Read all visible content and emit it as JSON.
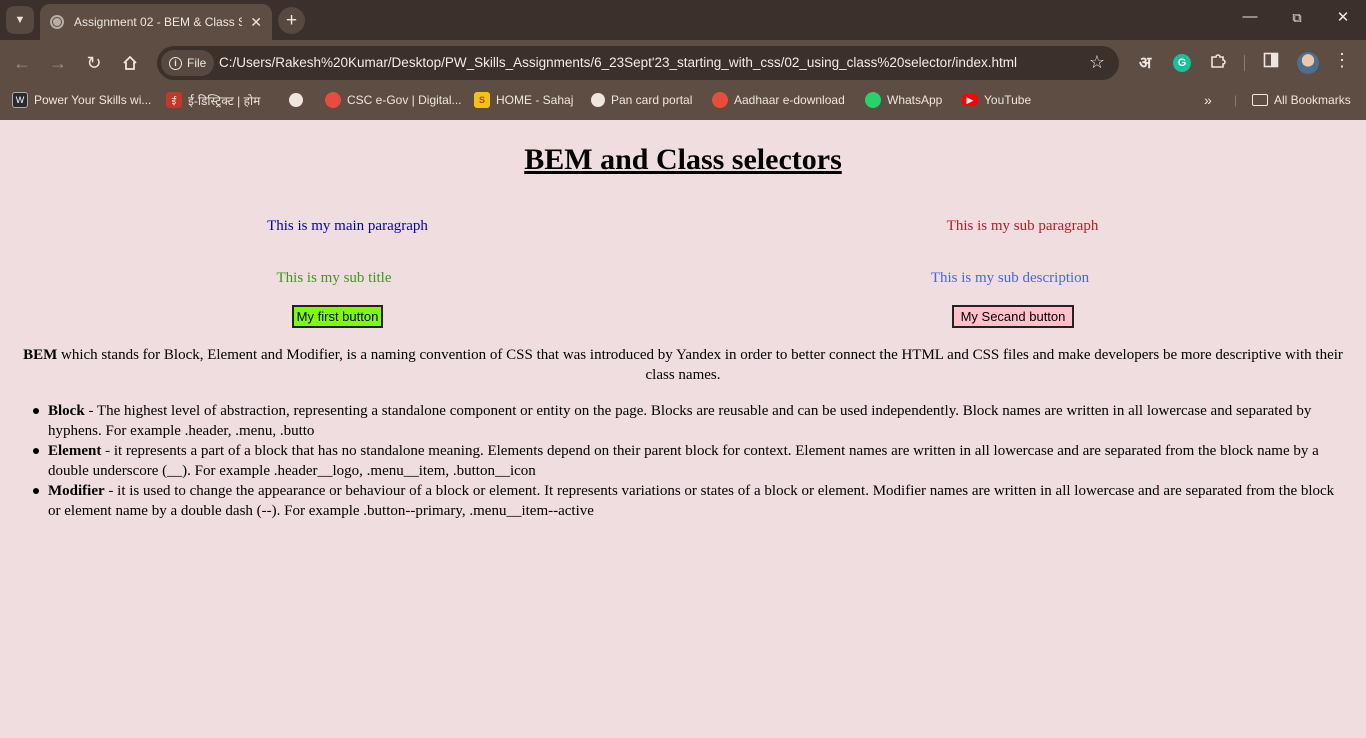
{
  "browser": {
    "tab_title": "Assignment 02 - BEM & Class Selectors",
    "url_scheme": "File",
    "url": "C:/Users/Rakesh%20Kumar/Desktop/PW_Skills_Assignments/6_23Sept'23_starting_with_css/02_using_class%20selector/index.html",
    "ext_letter": "अ",
    "bookmarks": [
      "Power Your Skills wi...",
      "ई-डिस्ट्रिक्ट | होम",
      "CSC e-Gov | Digital...",
      "HOME - Sahaj",
      "Pan card portal",
      "Aadhaar e-download",
      "WhatsApp",
      "YouTube"
    ],
    "all_bookmarks": "All Bookmarks"
  },
  "page": {
    "heading": "BEM and Class selectors",
    "main_paragraph": "This is my main paragraph",
    "sub_paragraph": "This is my sub paragraph",
    "sub_title": "This is my sub title",
    "sub_description": "This is my sub description",
    "first_button": "My first button",
    "second_button": "My Secand button",
    "intro_bold": "BEM",
    "intro_text": "  which stands for Block, Element and Modifier, is a naming convention of CSS that was introduced by Yandex in order to better connect the HTML and CSS files and make developers be more descriptive with their class names.",
    "items": [
      {
        "term": "Block",
        "text": " - The highest level of abstraction, representing a standalone component or entity on the page. Blocks are reusable and can be used independently. Block names are written in all lowercase and separated by hyphens. For example .header, .menu, .butto"
      },
      {
        "term": "Element",
        "text": " - it represents a part of a block that has no standalone meaning. Elements depend on their parent block for context. Element names are written in all lowercase and are separated from the block name by a double underscore (__). For example .header__logo, .menu__item, .button__icon"
      },
      {
        "term": "Modifier",
        "text": " - it is used to change the appearance or behaviour of a block or element. It represents variations or states of a block or element. Modifier names are written in all lowercase and are separated from the block or element name by a double dash (--). For example .button--primary, .menu__item--active"
      }
    ]
  },
  "colors": {
    "page_bg": "#f0dde0",
    "main_paragraph": "#0000cc",
    "sub_paragraph": "#b22222",
    "sub_title": "#3d9a1a",
    "sub_description": "#4169e1",
    "first_button_bg": "#7cfc00",
    "second_button_bg": "#ffc0cb"
  }
}
